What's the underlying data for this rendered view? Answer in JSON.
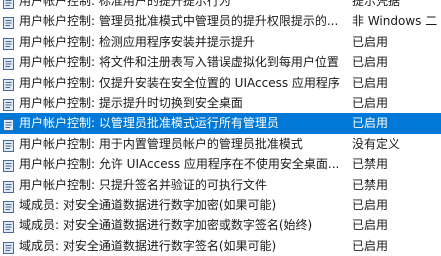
{
  "policies": [
    {
      "name": "用户帐户控制: 标准用户的提升提示行为",
      "setting": "提示凭据",
      "icon": "policy-icon"
    },
    {
      "name": "用户帐户控制: 管理员批准模式中管理员的提升权限提示的...",
      "setting": "非 Windows 二",
      "icon": "policy-icon"
    },
    {
      "name": "用户帐户控制: 检测应用程序安装并提示提升",
      "setting": "已启用",
      "icon": "policy-icon"
    },
    {
      "name": "用户帐户控制: 将文件和注册表写入错误虚拟化到每用户位置",
      "setting": "已启用",
      "icon": "policy-icon"
    },
    {
      "name": "用户帐户控制: 仅提升安装在安全位置的 UIAccess 应用程序",
      "setting": "已启用",
      "icon": "policy-icon"
    },
    {
      "name": "用户帐户控制: 提示提升时切换到安全桌面",
      "setting": "已启用",
      "icon": "policy-icon"
    },
    {
      "name": "用户帐户控制: 以管理员批准模式运行所有管理员",
      "setting": "已启用",
      "icon": "policy-icon",
      "selected": true
    },
    {
      "name": "用户帐户控制: 用于内置管理员帐户的管理员批准模式",
      "setting": "没有定义",
      "icon": "policy-icon"
    },
    {
      "name": "用户帐户控制: 允许 UIAccess 应用程序在不使用安全桌面...",
      "setting": "已禁用",
      "icon": "policy-icon"
    },
    {
      "name": "用户帐户控制: 只提升签名并验证的可执行文件",
      "setting": "已禁用",
      "icon": "policy-icon"
    },
    {
      "name": "域成员: 对安全通道数据进行数字加密(如果可能)",
      "setting": "已启用",
      "icon": "policy-icon"
    },
    {
      "name": "域成员: 对安全通道数据进行数字加密或数字签名(始终)",
      "setting": "已启用",
      "icon": "policy-icon"
    },
    {
      "name": "域成员: 对安全通道数据进行数字签名(如果可能)",
      "setting": "已启用",
      "icon": "policy-icon"
    }
  ],
  "colors": {
    "selection": "#0078d7",
    "icon_border": "#4a6a94",
    "icon_fill": "#dfe9f5"
  }
}
